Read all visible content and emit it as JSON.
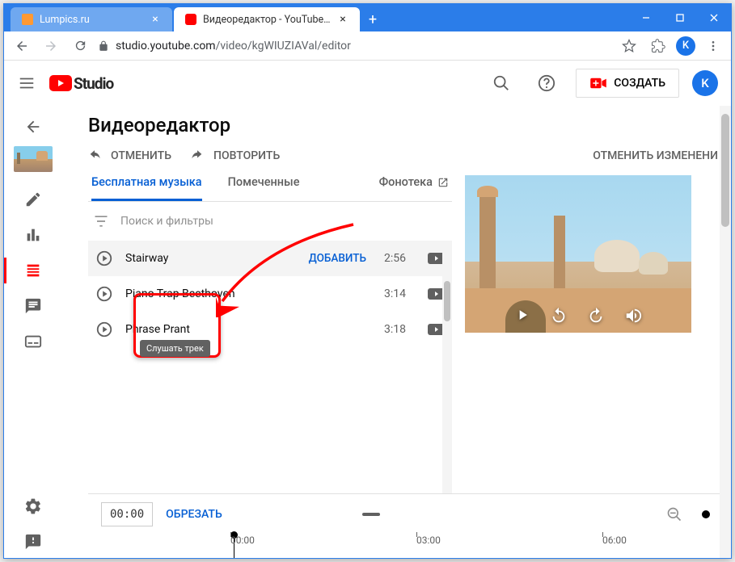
{
  "browser": {
    "tabs": [
      {
        "title": "Lumpics.ru",
        "favicon": "#ff9933",
        "active": false
      },
      {
        "title": "Видеоредактор - YouTube Studi",
        "favicon": "#ff0000",
        "active": true
      }
    ],
    "url_host": "studio.youtube.com",
    "url_path": "/video/kgWIUZIAVal/editor",
    "avatar_letter": "K"
  },
  "header": {
    "logo_text": "Studio",
    "create_label": "СОЗДАТЬ",
    "avatar_letter": "K"
  },
  "page": {
    "title": "Видеоредактор",
    "undo": "ОТМЕНИТЬ",
    "redo": "ПОВТОРИТЬ",
    "discard": "ОТМЕНИТЬ ИЗМЕНЕНИ"
  },
  "music": {
    "tab_free": "Бесплатная музыка",
    "tab_starred": "Помеченные",
    "tab_library": "Фонотека",
    "search_placeholder": "Поиск и фильтры",
    "add_label": "ДОБАВИТЬ",
    "tracks": [
      {
        "name": "Stairway",
        "dur": "2:56",
        "hover": true,
        "showAdd": true
      },
      {
        "name": "Piano Trap Beethoven",
        "dur": "3:14",
        "hover": false,
        "showAdd": false
      },
      {
        "name": "Phrase Prant",
        "dur": "3:18",
        "hover": false,
        "showAdd": false
      }
    ],
    "tooltip": "Слушать трек"
  },
  "timeline": {
    "time": "00:00",
    "trim": "ОБРЕЗАТЬ",
    "marks": [
      "00:00",
      "03:00",
      "06:00"
    ]
  }
}
